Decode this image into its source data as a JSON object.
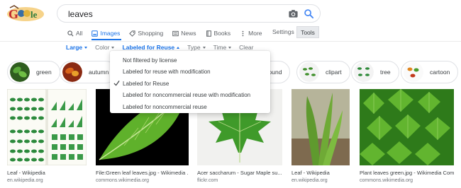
{
  "header": {
    "logo_text": "Google",
    "search_query": "leaves"
  },
  "tabs": [
    {
      "label": "All",
      "icon": "search-icon",
      "active": false
    },
    {
      "label": "Images",
      "icon": "image-icon",
      "active": true
    },
    {
      "label": "Shopping",
      "icon": "tag-icon",
      "active": false
    },
    {
      "label": "News",
      "icon": "news-icon",
      "active": false
    },
    {
      "label": "Books",
      "icon": "book-icon",
      "active": false
    },
    {
      "label": "More",
      "icon": "more-dots-icon",
      "active": false
    }
  ],
  "settings_label": "Settings",
  "tools_label": "Tools",
  "filters": {
    "size": "Large",
    "color": "Color",
    "usage_rights": "Labeled for Reuse",
    "type": "Type",
    "time": "Time",
    "clear": "Clear"
  },
  "chips": [
    {
      "label": "green"
    },
    {
      "label": "autumn"
    },
    {
      "label": "ground"
    },
    {
      "label": "clipart"
    },
    {
      "label": "tree"
    },
    {
      "label": "cartoon"
    }
  ],
  "dropdown": {
    "items": [
      {
        "label": "Not filtered by license",
        "checked": false
      },
      {
        "label": "Labeled for reuse with modification",
        "checked": false
      },
      {
        "label": "Labeled for Reuse",
        "checked": true
      },
      {
        "label": "Labeled for noncommercial reuse with modification",
        "checked": false
      },
      {
        "label": "Labeled for noncommercial reuse",
        "checked": false
      }
    ]
  },
  "results": [
    {
      "title": "Leaf - Wikipedia",
      "source": "en.wikipedia.org"
    },
    {
      "title": "File:Green leaf leaves.jpg - Wikimedia ...",
      "source": "commons.wikimedia.org"
    },
    {
      "title": "Acer saccharum - Sugar Maple su...",
      "source": "flickr.com"
    },
    {
      "title": "Leaf - Wikipedia",
      "source": "en.wikipedia.org"
    },
    {
      "title": "Plant leaves green.jpg - Wikimedia Com...",
      "source": "commons.wikimedia.org"
    }
  ],
  "colors": {
    "accent": "#1a73e8",
    "text": "#202124",
    "muted": "#70757a",
    "border": "#dfe1e5"
  }
}
